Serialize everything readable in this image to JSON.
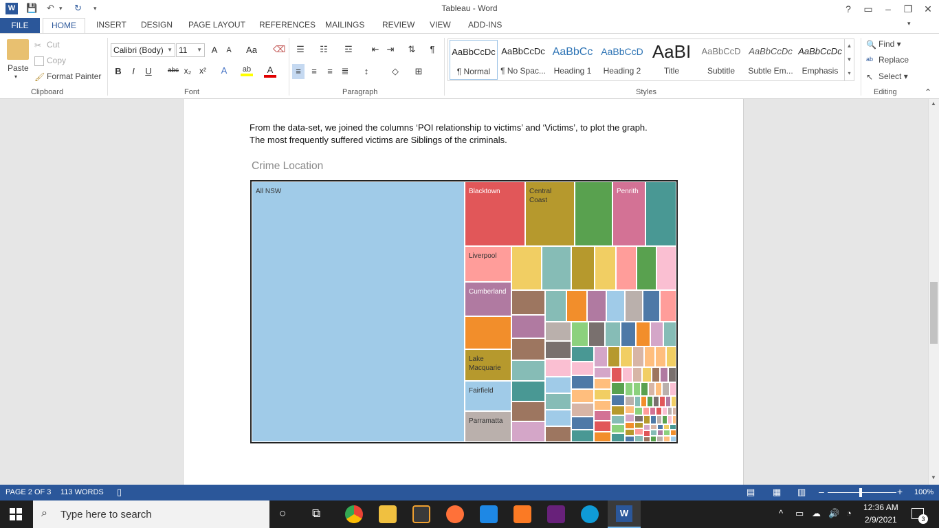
{
  "app": {
    "title": "Tableau - Word",
    "logo_letter": "W",
    "window_controls": [
      "?",
      "▭",
      "–",
      "❐",
      "✕"
    ],
    "user_chevron": "▾"
  },
  "tabs": [
    "FILE",
    "HOME",
    "INSERT",
    "DESIGN",
    "PAGE LAYOUT",
    "REFERENCES",
    "MAILINGS",
    "REVIEW",
    "VIEW",
    "ADD-INS"
  ],
  "clipboard": {
    "paste": "Paste",
    "cut": "Cut",
    "copy": "Copy",
    "format_painter": "Format Painter",
    "group": "Clipboard"
  },
  "font": {
    "name": "Calibri (Body)",
    "size": "11",
    "group": "Font",
    "grow": "A",
    "shrink": "A",
    "change_case": "Aa",
    "bold": "B",
    "italic": "I",
    "underline": "U",
    "strike": "abc",
    "sub": "x₂",
    "sup": "x²",
    "effects": "A",
    "highlight": "ab",
    "color": "A"
  },
  "paragraph": {
    "group": "Paragraph",
    "pilcrow": "¶"
  },
  "styles": {
    "group": "Styles",
    "items": [
      {
        "sample": "AaBbCcDc",
        "name": "¶ Normal"
      },
      {
        "sample": "AaBbCcDc",
        "name": "¶ No Spac..."
      },
      {
        "sample": "AaBbCc",
        "name": "Heading 1"
      },
      {
        "sample": "AaBbCcD",
        "name": "Heading 2"
      },
      {
        "sample": "AaBI",
        "name": "Title"
      },
      {
        "sample": "AaBbCcD",
        "name": "Subtitle"
      },
      {
        "sample": "AaBbCcDc",
        "name": "Subtle Em..."
      },
      {
        "sample": "AaBbCcDc",
        "name": "Emphasis"
      }
    ]
  },
  "editing": {
    "group": "Editing",
    "find": "Find",
    "replace": "Replace",
    "select": "Select"
  },
  "document": {
    "paragraph_line1": "From the data-set, we joined the columns ‘POI relationship to victims’ and ‘Victims’, to plot the graph.",
    "paragraph_line2": "The most frequently suffered victims are Siblings of the criminals.",
    "heading": "Crime Location",
    "treemap_labels": {
      "all_nsw": "All NSW",
      "blacktown": "Blacktown",
      "central_coast": "Central Coast",
      "penrith": "Penrith",
      "liverpool": "Liverpool",
      "cumberland": "Cumberland",
      "lake_macquarie": "Lake Macquarie",
      "fairfield": "Fairfield",
      "parramatta": "Parramatta"
    }
  },
  "status": {
    "page": "PAGE 2 OF 3",
    "words": "113 WORDS",
    "zoom": "100%"
  },
  "taskbar": {
    "search_placeholder": "Type here to search",
    "time": "12:36 AM",
    "date": "2/9/2021",
    "notifications": "3"
  },
  "colors": {
    "word_blue": "#2b579a",
    "tableau_palette": [
      "#a0cbe8",
      "#e15759",
      "#b6992d",
      "#59a14f",
      "#d37295",
      "#499894",
      "#ff9d9a",
      "#f1ce63",
      "#86bcb6",
      "#b07aa1",
      "#9d7660",
      "#f28e2b",
      "#bab0ac",
      "#4e79a7",
      "#79706e",
      "#fabfd2",
      "#8cd17d",
      "#ffbe7d",
      "#d4a6c8",
      "#d7b5a6"
    ]
  }
}
